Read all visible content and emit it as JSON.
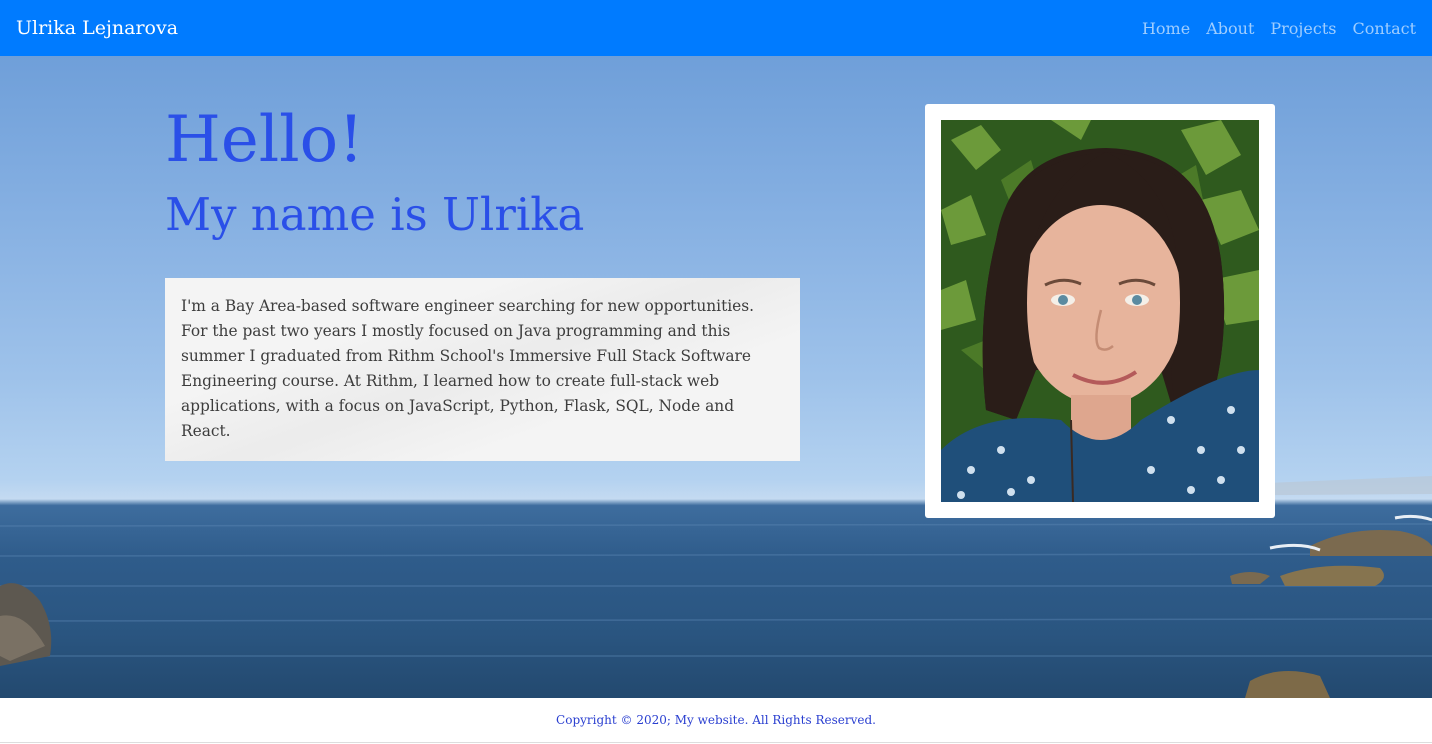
{
  "navbar": {
    "brand": "Ulrika Lejnarova",
    "links": [
      "Home",
      "About",
      "Projects",
      "Contact"
    ]
  },
  "hero": {
    "greeting": "Hello!",
    "subtitle": "My name is Ulrika",
    "bio": "I'm a Bay Area-based software engineer searching for new opportunities. For the past two years I mostly focused on Java programming and this summer I graduated from Rithm School's Immersive Full Stack Software Engineering course. At Rithm, I learned how to create full-stack web applications, with a focus on JavaScript, Python, Flask, SQL, Node and React."
  },
  "footer": {
    "copyright": "Copyright © 2020; My website. All Rights Reserved."
  },
  "colors": {
    "navbar_bg": "#007bff",
    "heading": "#2a4fe8",
    "footer_text": "#2a3fd0"
  }
}
